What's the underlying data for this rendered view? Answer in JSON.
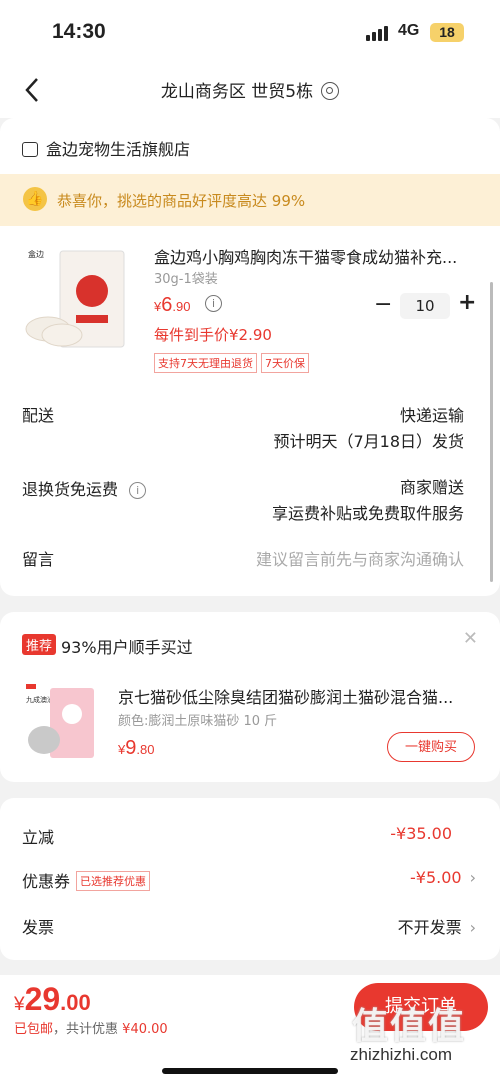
{
  "status": {
    "time": "14:30",
    "network": "4G",
    "battery": "18"
  },
  "nav": {
    "title": "龙山商务区 世贸5栋"
  },
  "shop": {
    "name": "盒边宠物生活旗舰店"
  },
  "banner": {
    "text": "恭喜你，挑选的商品好评度高达 99%"
  },
  "product": {
    "title": "盒边鸡小胸鸡胸肉冻干猫零食成幼猫补充...",
    "spec": "30g-1袋装",
    "price_symbol": "¥",
    "price_int": "6",
    "price_dec": ".90",
    "quantity": "10",
    "unit_price": "每件到手价¥2.90",
    "tags": [
      "支持7天无理由退货",
      "7天价保"
    ]
  },
  "delivery": {
    "label": "配送",
    "method": "快递运输",
    "eta": "预计明天（7月18日）发货"
  },
  "returns": {
    "label": "退换货免运费",
    "value": "商家赠送",
    "detail": "享运费补贴或免费取件服务"
  },
  "message": {
    "label": "留言",
    "placeholder": "建议留言前先与商家沟通确认"
  },
  "reco": {
    "badge": "推荐",
    "title": "93%用户顺手买过",
    "name": "京七猫砂低尘除臭结团猫砂膨润土猫砂混合猫...",
    "spec": "颜色:膨润土原味猫砂 10 斤",
    "price_symbol": "¥",
    "price_int": "9",
    "price_dec": ".80",
    "button": "一键购买"
  },
  "summary": {
    "discount_label": "立减",
    "discount_value": "-¥35.00",
    "coupon_label": "优惠券",
    "coupon_tag": "已选推荐优惠",
    "coupon_value": "-¥5.00",
    "invoice_label": "发票",
    "invoice_value": "不开发票"
  },
  "footer": {
    "total_symbol": "¥",
    "total_int": "29",
    "total_dec": ".00",
    "shipping": "已包邮",
    "saving_prefix": "，共计优惠",
    "saving_value": "¥40.00",
    "submit": "提交订单"
  },
  "watermark": {
    "text": "值值值",
    "url": "zhizhizhi.com"
  },
  "colors": {
    "accent": "#e8382f",
    "banner_bg": "#fdf0d6",
    "banner_text": "#c88a1e"
  }
}
